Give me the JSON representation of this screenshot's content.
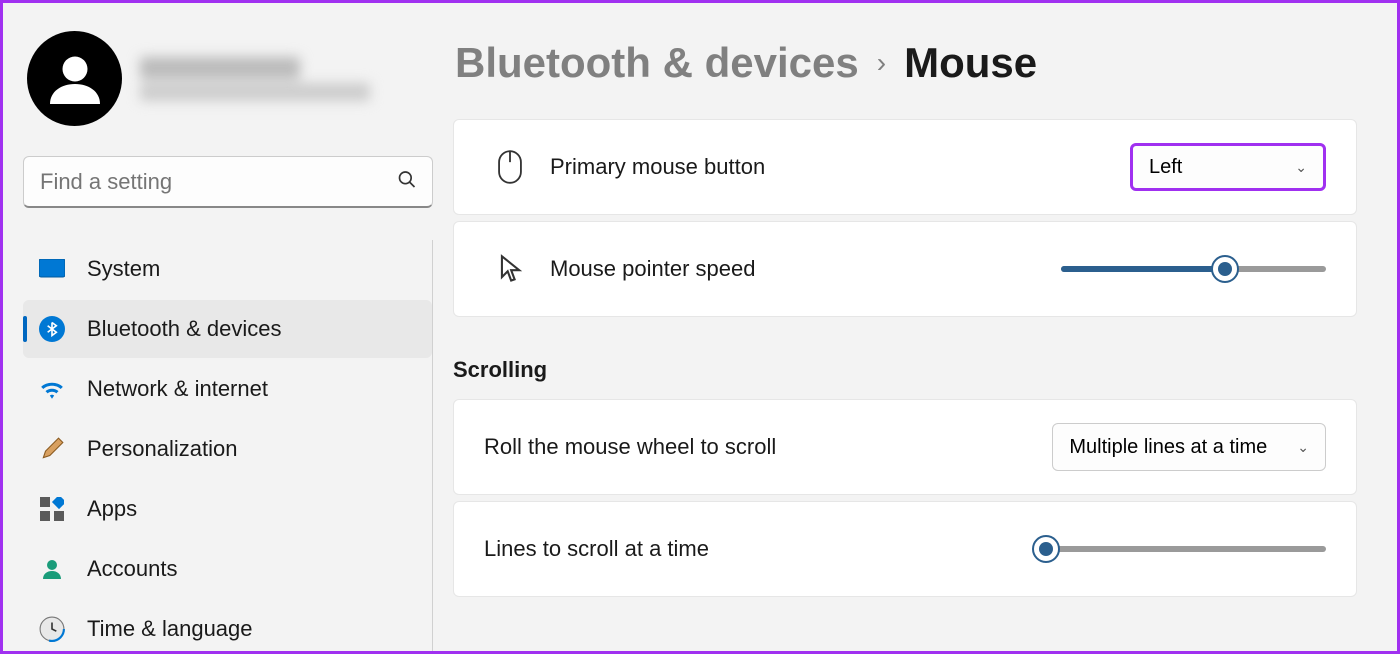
{
  "search": {
    "placeholder": "Find a setting"
  },
  "nav": [
    {
      "label": "System",
      "icon": "system"
    },
    {
      "label": "Bluetooth & devices",
      "icon": "bluetooth",
      "active": true
    },
    {
      "label": "Network & internet",
      "icon": "wifi"
    },
    {
      "label": "Personalization",
      "icon": "brush"
    },
    {
      "label": "Apps",
      "icon": "apps"
    },
    {
      "label": "Accounts",
      "icon": "account"
    },
    {
      "label": "Time & language",
      "icon": "clock"
    }
  ],
  "breadcrumb": {
    "parent": "Bluetooth & devices",
    "current": "Mouse"
  },
  "settings": {
    "primary_button": {
      "label": "Primary mouse button",
      "value": "Left"
    },
    "pointer_speed": {
      "label": "Mouse pointer speed",
      "value_pct": 62
    },
    "scrolling_header": "Scrolling",
    "roll_wheel": {
      "label": "Roll the mouse wheel to scroll",
      "value": "Multiple lines at a time"
    },
    "lines_scroll": {
      "label": "Lines to scroll at a time",
      "value_pct": 3
    }
  }
}
